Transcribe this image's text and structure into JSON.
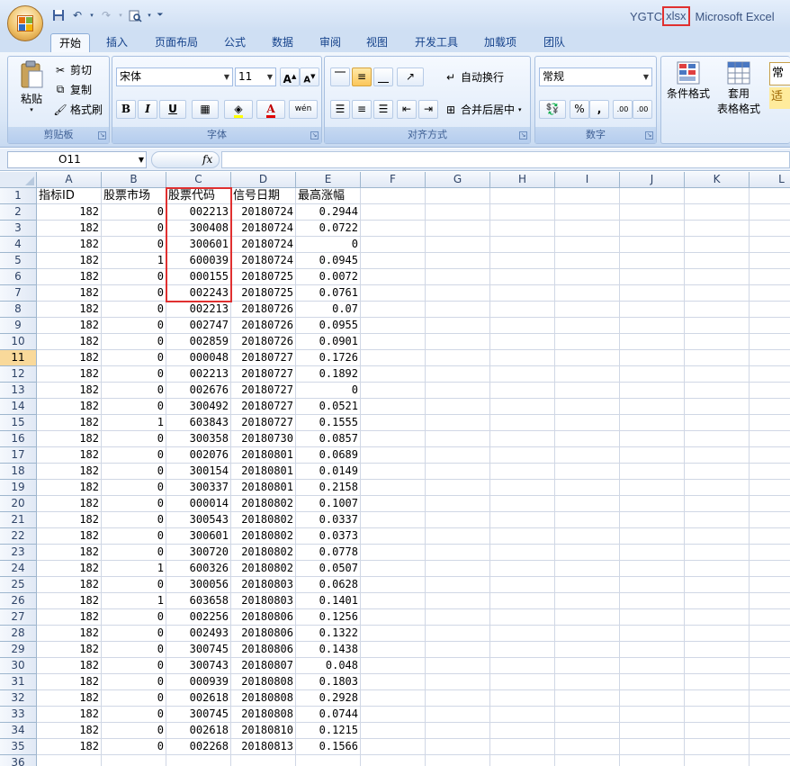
{
  "window": {
    "file_name": "YGTC",
    "file_ext": "xlsx",
    "app_name": "Microsoft Excel"
  },
  "quick_access": [
    "save-icon",
    "undo-icon",
    "redo-icon",
    "print-preview-icon",
    "customize-arrow-icon"
  ],
  "tabs": [
    "开始",
    "插入",
    "页面布局",
    "公式",
    "数据",
    "审阅",
    "视图",
    "开发工具",
    "加载项",
    "团队"
  ],
  "active_tab": "开始",
  "ribbon": {
    "clipboard": {
      "label": "剪贴板",
      "paste": "粘贴",
      "cut": "剪切",
      "copy": "复制",
      "format_painter": "格式刷"
    },
    "font": {
      "label": "字体",
      "font_name": "宋体",
      "font_size": "11",
      "bold": "B",
      "italic": "I",
      "underline": "U",
      "grow": "A",
      "shrink": "A",
      "phonetic": "wén"
    },
    "alignment": {
      "label": "对齐方式",
      "wrap_text": "自动换行",
      "merge_center": "合并后居中"
    },
    "number": {
      "label": "数字",
      "format": "常规",
      "percent": "%",
      "comma": ",",
      "increase_decimal": ".00",
      "decrease_decimal": ".00"
    },
    "styles": {
      "conditional_format": "条件格式",
      "table_format_1": "套用",
      "table_format_2": "表格格式",
      "cell_style_1": "常",
      "cell_style_2": "适"
    }
  },
  "formula_bar": {
    "name_box": "O11",
    "fx_label": "fx",
    "formula": ""
  },
  "sheet": {
    "columns": [
      "A",
      "B",
      "C",
      "D",
      "E",
      "F",
      "G",
      "H",
      "I",
      "J",
      "K",
      "L"
    ],
    "selected_row": 11,
    "headers": [
      "指标ID",
      "股票市场",
      "股票代码",
      "信号日期",
      "最高涨幅"
    ],
    "rows": [
      [
        "182",
        "0",
        "002213",
        "20180724",
        "0.2944"
      ],
      [
        "182",
        "0",
        "300408",
        "20180724",
        "0.0722"
      ],
      [
        "182",
        "0",
        "300601",
        "20180724",
        "0"
      ],
      [
        "182",
        "1",
        "600039",
        "20180724",
        "0.0945"
      ],
      [
        "182",
        "0",
        "000155",
        "20180725",
        "0.0072"
      ],
      [
        "182",
        "0",
        "002243",
        "20180725",
        "0.0761"
      ],
      [
        "182",
        "0",
        "002213",
        "20180726",
        "0.07"
      ],
      [
        "182",
        "0",
        "002747",
        "20180726",
        "0.0955"
      ],
      [
        "182",
        "0",
        "002859",
        "20180726",
        "0.0901"
      ],
      [
        "182",
        "0",
        "000048",
        "20180727",
        "0.1726"
      ],
      [
        "182",
        "0",
        "002213",
        "20180727",
        "0.1892"
      ],
      [
        "182",
        "0",
        "002676",
        "20180727",
        "0"
      ],
      [
        "182",
        "0",
        "300492",
        "20180727",
        "0.0521"
      ],
      [
        "182",
        "1",
        "603843",
        "20180727",
        "0.1555"
      ],
      [
        "182",
        "0",
        "300358",
        "20180730",
        "0.0857"
      ],
      [
        "182",
        "0",
        "002076",
        "20180801",
        "0.0689"
      ],
      [
        "182",
        "0",
        "300154",
        "20180801",
        "0.0149"
      ],
      [
        "182",
        "0",
        "300337",
        "20180801",
        "0.2158"
      ],
      [
        "182",
        "0",
        "000014",
        "20180802",
        "0.1007"
      ],
      [
        "182",
        "0",
        "300543",
        "20180802",
        "0.0337"
      ],
      [
        "182",
        "0",
        "300601",
        "20180802",
        "0.0373"
      ],
      [
        "182",
        "0",
        "300720",
        "20180802",
        "0.0778"
      ],
      [
        "182",
        "1",
        "600326",
        "20180802",
        "0.0507"
      ],
      [
        "182",
        "0",
        "300056",
        "20180803",
        "0.0628"
      ],
      [
        "182",
        "1",
        "603658",
        "20180803",
        "0.1401"
      ],
      [
        "182",
        "0",
        "002256",
        "20180806",
        "0.1256"
      ],
      [
        "182",
        "0",
        "002493",
        "20180806",
        "0.1322"
      ],
      [
        "182",
        "0",
        "300745",
        "20180806",
        "0.1438"
      ],
      [
        "182",
        "0",
        "300743",
        "20180807",
        "0.048"
      ],
      [
        "182",
        "0",
        "000939",
        "20180808",
        "0.1803"
      ],
      [
        "182",
        "0",
        "002618",
        "20180808",
        "0.2928"
      ],
      [
        "182",
        "0",
        "300745",
        "20180808",
        "0.0744"
      ],
      [
        "182",
        "0",
        "002618",
        "20180810",
        "0.1215"
      ],
      [
        "182",
        "0",
        "002268",
        "20180813",
        "0.1566"
      ]
    ]
  },
  "colors": {
    "highlight": "#e03030",
    "selected_row_header": "#f9d99a",
    "ribbon_tab_text": "#15428b"
  }
}
